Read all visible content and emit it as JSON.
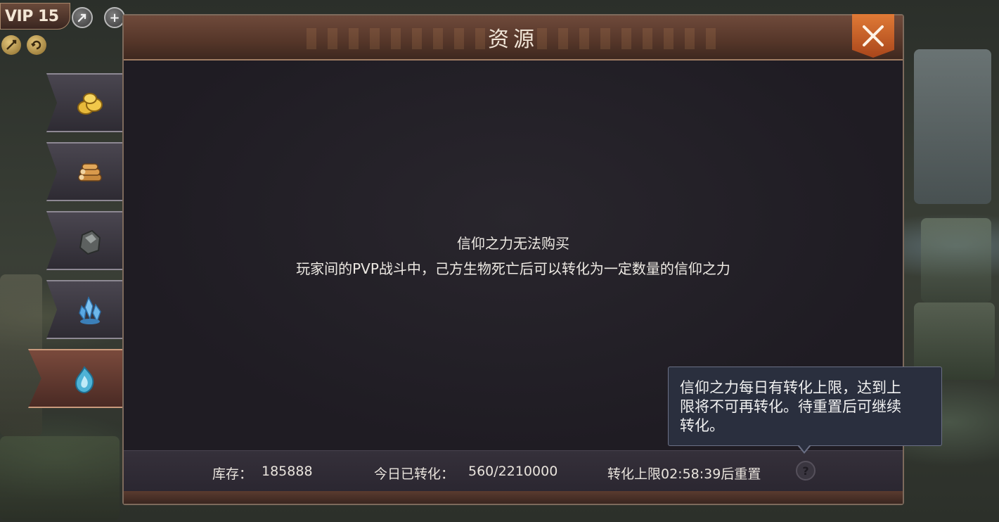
{
  "hud": {
    "vip_label": "VIP 15",
    "boost_icon": "arrow-boost-icon",
    "add_icon": "plus-icon",
    "add_glyph": "+"
  },
  "side_tabs": [
    {
      "icon": "gold-coins-icon",
      "active": false
    },
    {
      "icon": "wood-logs-icon",
      "active": false
    },
    {
      "icon": "stone-ore-icon",
      "active": false
    },
    {
      "icon": "crystal-icon",
      "active": false
    },
    {
      "icon": "faith-flame-icon",
      "active": true
    }
  ],
  "dialog": {
    "title": "资源",
    "close_icon": "close-x-icon",
    "message_line1": "信仰之力无法购买",
    "message_line2": "玩家间的PVP战斗中，己方生物死亡后可以转化为一定数量的信仰之力"
  },
  "footer": {
    "stock_label": "库存：",
    "stock_value": "185888",
    "converted_label": "今日已转化：",
    "converted_value": "560/2210000",
    "reset_text": "转化上限02:58:39后重置",
    "help_glyph": "?"
  },
  "tooltip": {
    "line1": "信仰之力每日有转化上限，达到上",
    "line2": "限将不可再转化。待重置后可继续",
    "line3": "转化。"
  },
  "colors": {
    "accent_orange": "#e07a36",
    "dialog_bg": "#221f26",
    "header_brown": "#6f4a3b",
    "tooltip_bg": "#2a2f3e"
  }
}
